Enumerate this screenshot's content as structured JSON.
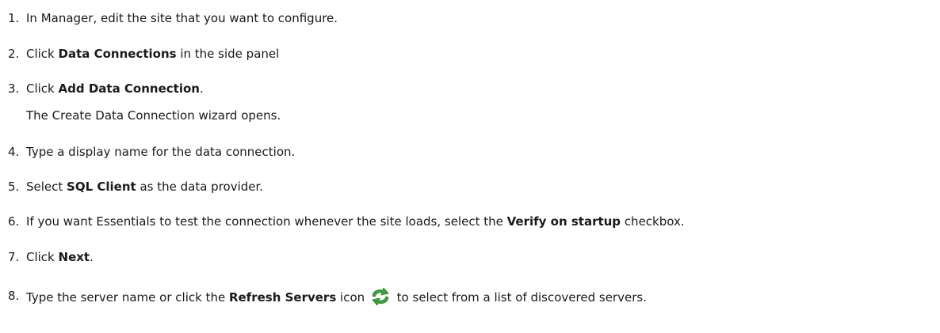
{
  "steps": [
    {
      "num": "1.",
      "parts": [
        {
          "t": "In Manager, edit the site that you want to configure."
        }
      ]
    },
    {
      "num": "2.",
      "parts": [
        {
          "t": "Click "
        },
        {
          "t": "Data Connections",
          "b": true
        },
        {
          "t": " in the side panel"
        }
      ]
    },
    {
      "num": "3.",
      "parts": [
        {
          "t": "Click "
        },
        {
          "t": "Add Data Connection",
          "b": true
        },
        {
          "t": "."
        }
      ],
      "sub": "The Create Data Connection wizard opens."
    },
    {
      "num": "4.",
      "parts": [
        {
          "t": "Type a display name for the data connection."
        }
      ]
    },
    {
      "num": "5.",
      "parts": [
        {
          "t": "Select "
        },
        {
          "t": "SQL Client",
          "b": true
        },
        {
          "t": " as the data provider."
        }
      ]
    },
    {
      "num": "6.",
      "parts": [
        {
          "t": "If you want Essentials to test the connection whenever the site loads, select the "
        },
        {
          "t": "Verify on startup",
          "b": true
        },
        {
          "t": " checkbox."
        }
      ]
    },
    {
      "num": "7.",
      "parts": [
        {
          "t": "Click "
        },
        {
          "t": "Next",
          "b": true
        },
        {
          "t": "."
        }
      ]
    },
    {
      "num": "8.",
      "parts": [
        {
          "t": "Type the server name or click the "
        },
        {
          "t": "Refresh Servers",
          "b": true
        },
        {
          "t": " icon "
        },
        {
          "icon": "refresh-icon"
        },
        {
          "t": " to select from a list of discovered servers."
        }
      ]
    }
  ],
  "colors": {
    "text": "#1a1a1a",
    "icon_green": "#3aa63a",
    "icon_dark_green": "#1f7a1f"
  }
}
